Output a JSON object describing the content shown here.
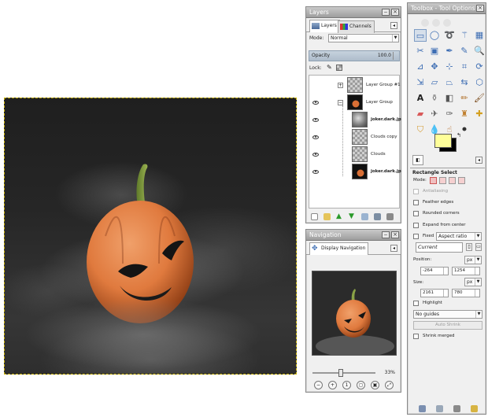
{
  "layers_panel": {
    "title": "Layers",
    "tabs": [
      {
        "label": "Layers"
      },
      {
        "label": "Channels"
      }
    ],
    "mode_label": "Mode:",
    "mode_value": "Normal",
    "opacity_label": "Opacity",
    "opacity_value": "100.0",
    "lock_label": "Lock:",
    "layers": [
      {
        "name": "Layer Group #1",
        "bold": false
      },
      {
        "name": "Layer Group",
        "bold": false
      },
      {
        "name": "joker.dark.jp",
        "bold": true
      },
      {
        "name": "Clouds copy",
        "bold": false
      },
      {
        "name": "Clouds",
        "bold": false
      },
      {
        "name": "joker.dark.jp",
        "bold": true
      }
    ]
  },
  "navigation_panel": {
    "title": "Navigation",
    "tab_label": "Display Navigation",
    "zoom_value": "33%"
  },
  "toolbox": {
    "title": "Toolbox - Tool Options",
    "tool_name": "Rectangle Select",
    "mode_label": "Mode:",
    "antialiasing_label": "Antialiasing",
    "feather_label": "Feather edges",
    "rounded_label": "Rounded corners",
    "expand_label": "Expand from center",
    "fixed_label": "Fixed",
    "fixed_value": "Aspect ratio",
    "ratio_value": "Current",
    "position_label": "Position:",
    "position_unit": "px",
    "position_x": "-264",
    "position_y": "1254",
    "size_label": "Size:",
    "size_unit": "px",
    "size_w": "2161",
    "size_h": "780",
    "highlight_label": "Highlight",
    "guides_value": "No guides",
    "auto_shrink_label": "Auto Shrink",
    "shrink_merged_label": "Shrink merged",
    "fg_color": "#ffff99",
    "bg_color": "#000000"
  }
}
